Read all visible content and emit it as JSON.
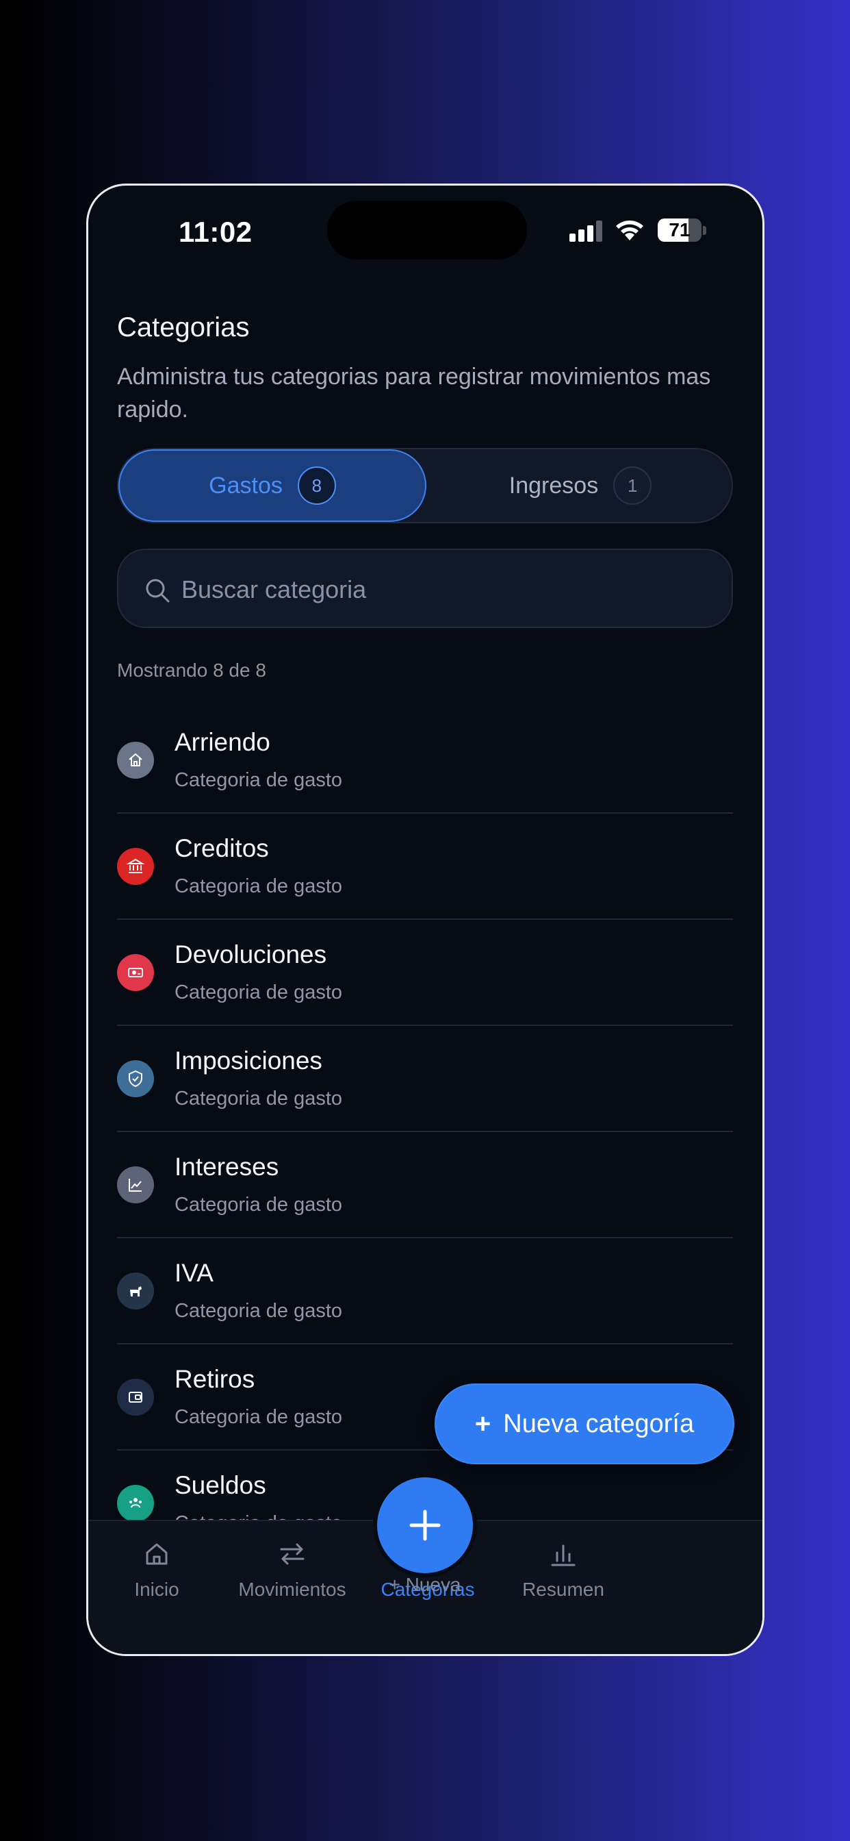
{
  "status_bar": {
    "time": "11:02",
    "battery": "71",
    "battery_level": 0.71
  },
  "page": {
    "title": "Categorias",
    "subtitle": "Administra tus categorias para registrar movimientos mas rapido."
  },
  "segments": [
    {
      "label": "Gastos",
      "count": "8",
      "active": true
    },
    {
      "label": "Ingresos",
      "count": "1",
      "active": false
    }
  ],
  "search": {
    "placeholder": "Buscar categoria",
    "value": ""
  },
  "count_text": "Mostrando 8 de 8",
  "categories": [
    {
      "name": "Arriendo",
      "sub": "Categoria de gasto",
      "icon": "home-icon",
      "color": "#6b7589"
    },
    {
      "name": "Creditos",
      "sub": "Categoria de gasto",
      "icon": "bank-icon",
      "color": "#dc2626"
    },
    {
      "name": "Devoluciones",
      "sub": "Categoria de gasto",
      "icon": "money-icon",
      "color": "#e0384a"
    },
    {
      "name": "Imposiciones",
      "sub": "Categoria de gasto",
      "icon": "shield-icon",
      "color": "#3f6f99"
    },
    {
      "name": "Intereses",
      "sub": "Categoria de gasto",
      "icon": "chart-icon",
      "color": "#5b6478"
    },
    {
      "name": "IVA",
      "sub": "Categoria de gasto",
      "icon": "dog-icon",
      "color": "#24354a"
    },
    {
      "name": "Retiros",
      "sub": "Categoria de gasto",
      "icon": "wallet-icon",
      "color": "#1e2d45"
    },
    {
      "name": "Sueldos",
      "sub": "Categoria de gasto",
      "icon": "people-icon",
      "color": "#16a085"
    }
  ],
  "new_category_button": {
    "plus": "+",
    "label": "Nueva categoría"
  },
  "tabbar": {
    "inicio": "Inicio",
    "movimientos": "Movimientos",
    "nueva": "+ Nueva",
    "categorias": "Categorías",
    "resumen": "Resumen"
  },
  "colors": {
    "accent": "#2f7cf2",
    "background": "#070b14"
  }
}
